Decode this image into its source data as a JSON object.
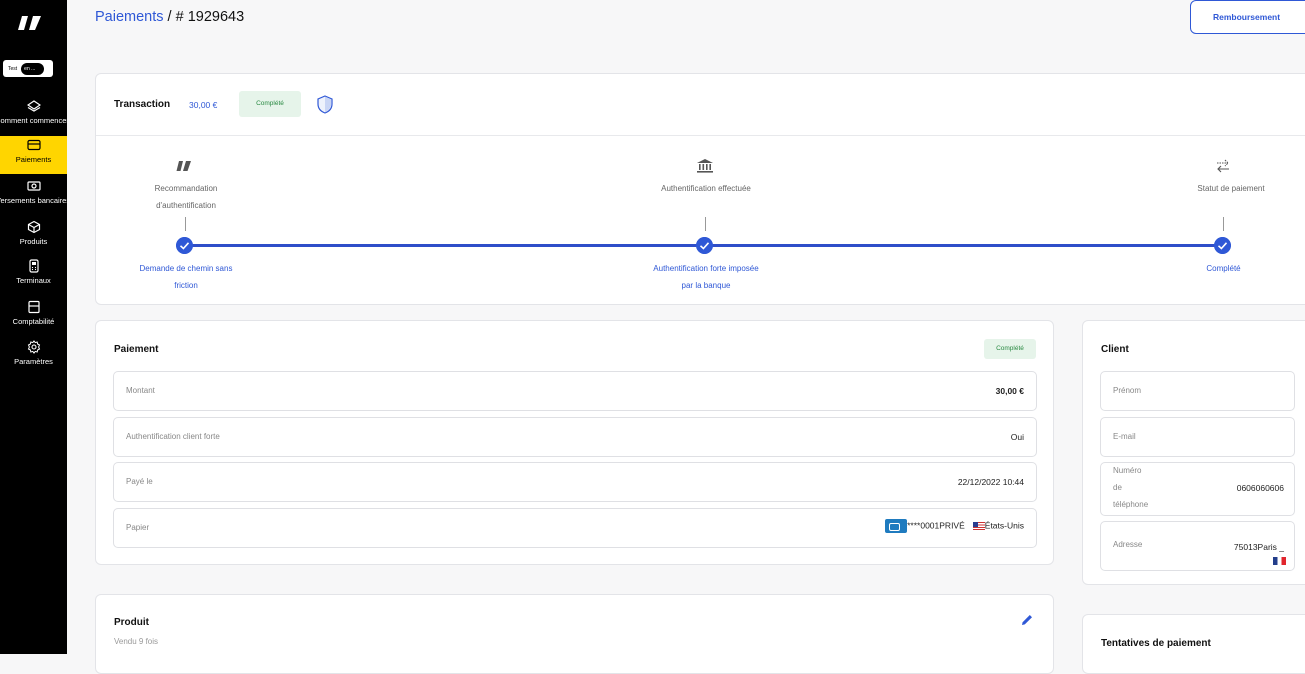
{
  "sidebar": {
    "logo_icon": "brand-logo-icon",
    "test_label": "Test",
    "test_switch": "en ...",
    "items": [
      {
        "label": "Comment commencer",
        "icon": "layers-icon"
      },
      {
        "label": "Paiements",
        "icon": "card-icon",
        "active": true
      },
      {
        "label": "Versements bancaires",
        "icon": "banknote-icon"
      },
      {
        "label": "Produits",
        "icon": "box-icon"
      },
      {
        "label": "Terminaux",
        "icon": "terminal-icon"
      },
      {
        "label": "Comptabilité",
        "icon": "ledger-icon"
      },
      {
        "label": "Paramètres",
        "icon": "gear-icon"
      }
    ]
  },
  "header": {
    "breadcrumb_link": "Paiements",
    "breadcrumb_rest": " / # 1929643",
    "refund_button": "Remboursement"
  },
  "transaction": {
    "title": "Transaction",
    "amount": "30,00 €",
    "status": "Complété",
    "steps_top": [
      {
        "line1": "Recommandation",
        "line2": "d'authentification"
      },
      {
        "line1": "Authentification effectuée",
        "line2": ""
      },
      {
        "line1": "Statut de paiement",
        "line2": ""
      }
    ],
    "steps_bottom": [
      {
        "line1": "Demande de chemin sans",
        "line2": "friction"
      },
      {
        "line1": "Authentification forte imposée",
        "line2": "par la banque"
      },
      {
        "line1": "Complété",
        "line2": ""
      }
    ]
  },
  "payment": {
    "title": "Paiement",
    "status": "Complété",
    "rows": [
      {
        "key": "Montant",
        "value": "30,00 €"
      },
      {
        "key": "Authentification client forte",
        "value": "Oui"
      },
      {
        "key": "Payé le",
        "value": "22/12/2022 10:44"
      },
      {
        "key": "Papier",
        "value": "****0001PRIVÉ",
        "country": "États-Unis"
      }
    ]
  },
  "client": {
    "title": "Client",
    "first_name_label": "Prénom",
    "email_label": "E-mail",
    "phone_label_1": "Numéro",
    "phone_label_2": "de",
    "phone_label_3": "téléphone",
    "phone_value": "0606060606",
    "address_label": "Adresse",
    "address_value": "75013Paris _"
  },
  "product": {
    "title": "Produit",
    "subtitle": "Vendu 9 fois"
  },
  "attempts": {
    "title": "Tentatives de paiement"
  },
  "colors": {
    "accent": "#2f58d6",
    "sidebar_bg": "#000000",
    "active_nav": "#ffd500",
    "success_bg": "#e6f4ea",
    "success_text": "#2a8a43"
  }
}
